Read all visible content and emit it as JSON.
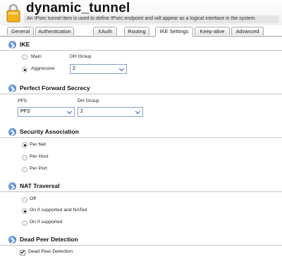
{
  "header": {
    "title": "dynamic_tunnel",
    "subtitle": "An IPsec tunnel item is used to define IPsec endpoint and will appear as a logical interface in the system."
  },
  "tabs": [
    {
      "label": "General"
    },
    {
      "label": "Authentication"
    },
    {
      "label": "XAuth"
    },
    {
      "label": "Routing"
    },
    {
      "label": "IKE Settings"
    },
    {
      "label": "Keep-alive"
    },
    {
      "label": "Advanced"
    }
  ],
  "ike": {
    "title": "IKE",
    "mode_main": "Main",
    "mode_aggressive": "Aggressive",
    "dh_group_label": "DH Group",
    "dh_group_value": "2"
  },
  "pfs": {
    "title": "Perfect Forward Secrecy",
    "pfs_label": "PFS",
    "pfs_value": "PFS",
    "dh_group_label": "DH Group",
    "dh_group_value": "2"
  },
  "sa": {
    "title": "Security Association",
    "options": [
      "Per Net",
      "Per Host",
      "Per Port"
    ]
  },
  "nat": {
    "title": "NAT Traversal",
    "options": [
      "Off",
      "On if supported and NATed",
      "On if supported"
    ]
  },
  "dpd": {
    "title": "Dead Peer Detection",
    "checkbox_label": "Dead Peer Detection"
  }
}
